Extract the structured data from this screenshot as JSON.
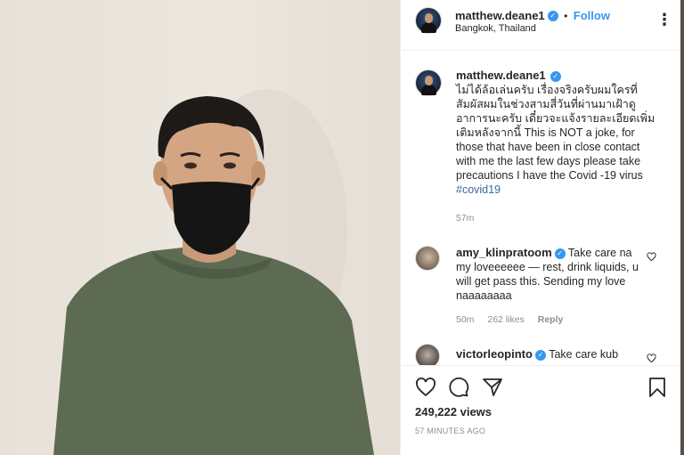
{
  "header": {
    "username": "matthew.deane1",
    "separator": "•",
    "follow_label": "Follow",
    "location": "Bangkok, Thailand",
    "more_label": "⋮"
  },
  "caption": {
    "username": "matthew.deane1",
    "text": "ไม่ได้ล้อเล่นครับ เรื่องจริงครับผมใครที่สัมผัสผมในช่วงสามสี่วันที่ผ่านมาเฝ้าดูอาการนะครับ เดี๋ยวจะแจ้งรายละเอียดเพิ่มเติมหลังจากนี้ This is NOT a joke, for those that have been in close contact with me the last few days please take precautions I have the Covid -19 virus",
    "hashtag": "#covid19",
    "time": "57m"
  },
  "comments": [
    {
      "username": "amy_klinpratoom",
      "text": "Take care na my loveeeeee — rest, drink liquids, u will get pass this. Sending my love naaaaaaaa",
      "time": "50m",
      "likes": "262 likes",
      "reply_label": "Reply"
    },
    {
      "username": "victorleopinto",
      "text": "Take care kub"
    }
  ],
  "stats": {
    "views": "249,222 views",
    "posted": "57 MINUTES AGO"
  },
  "icons": {
    "like": "heart-icon",
    "comment": "speech-bubble-icon",
    "share": "paper-plane-icon",
    "save": "bookmark-icon",
    "verified": "verified-badge-icon"
  },
  "colors": {
    "accent": "#3897f0",
    "hashtag": "#3d6a9f",
    "muted": "#8e8e8e"
  }
}
